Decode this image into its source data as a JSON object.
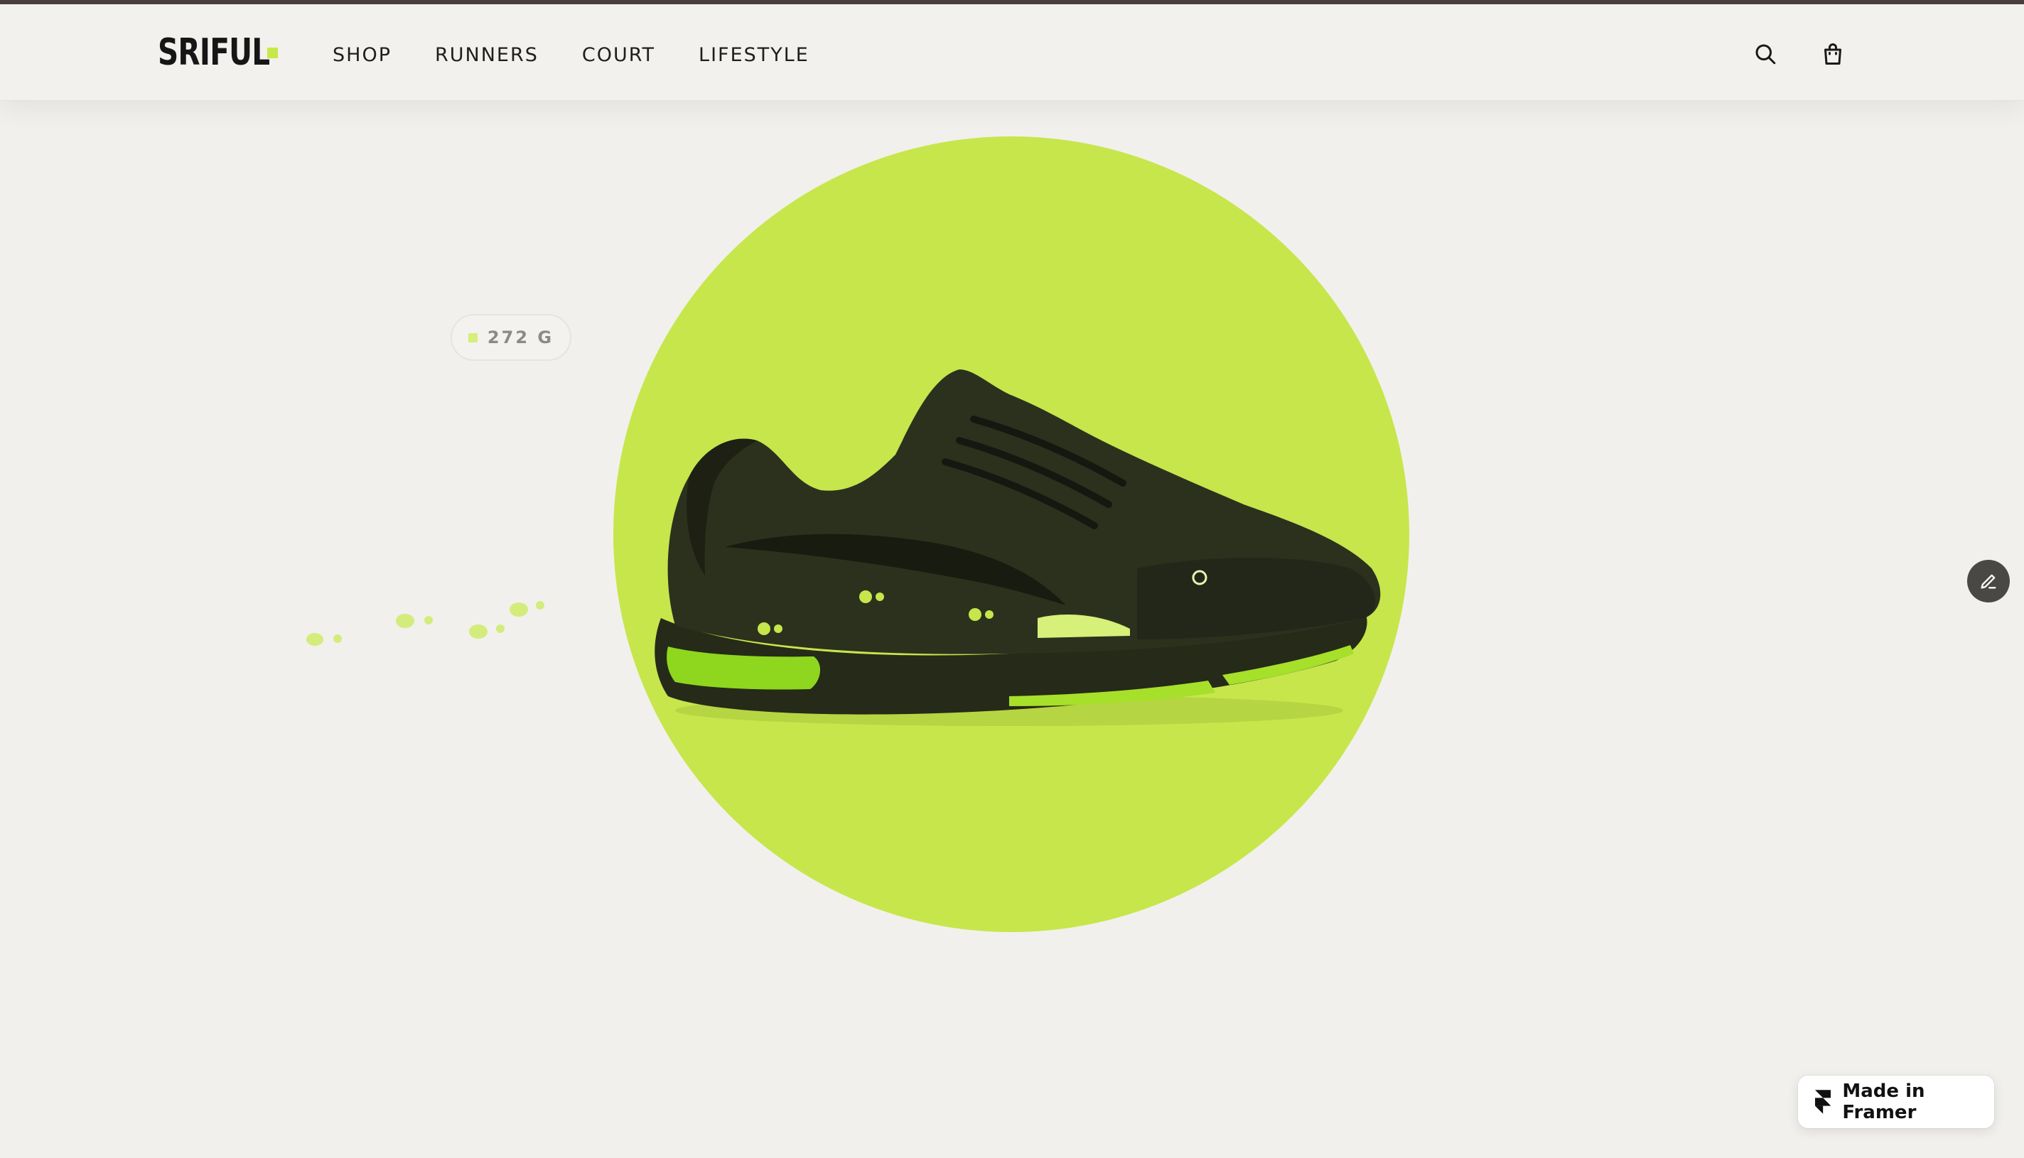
{
  "brand": {
    "logo_text": "SRIFUL",
    "accent_color": "#C6E64C"
  },
  "nav": {
    "items": [
      {
        "label": "SHOP"
      },
      {
        "label": "RUNNERS"
      },
      {
        "label": "COURT"
      },
      {
        "label": "LIFESTYLE"
      }
    ],
    "icons": {
      "search": "search-icon",
      "bag": "shopping-bag-icon"
    }
  },
  "hero": {
    "weight_badge": "272 G",
    "image": "sneaker-image",
    "circle_color": "#C6E64C"
  },
  "floating": {
    "edit_icon": "pencil-icon"
  },
  "footer_badge": {
    "label": "Made in Framer",
    "icon": "framer-logo-icon"
  }
}
